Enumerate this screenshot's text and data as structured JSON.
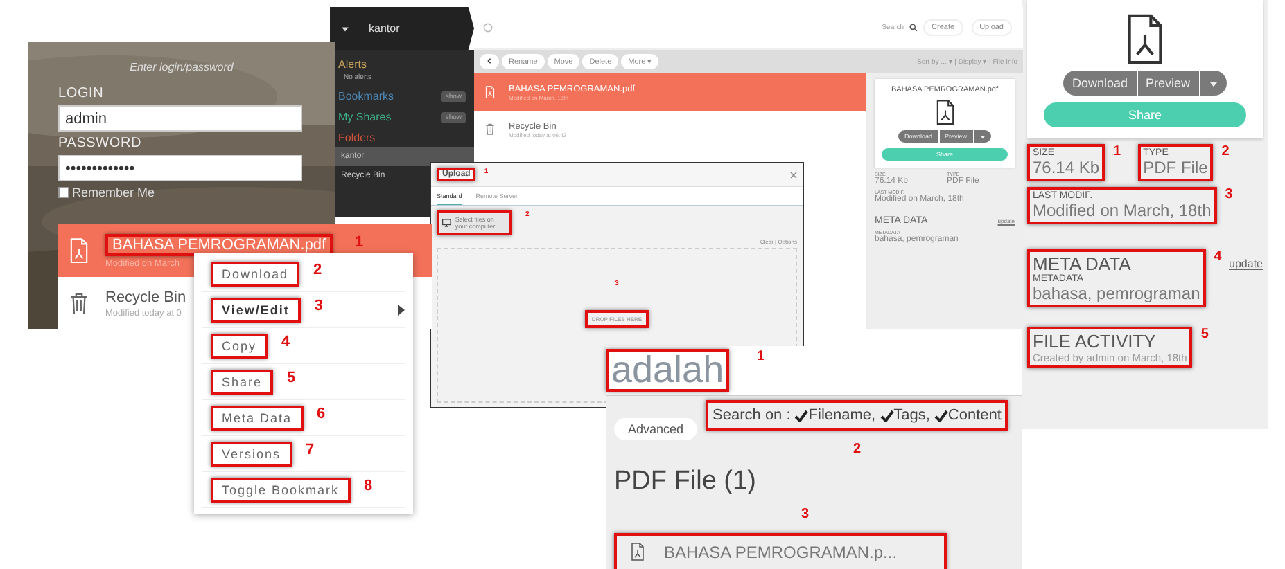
{
  "login": {
    "hint": "Enter login/password",
    "login_label": "LOGIN",
    "login_value": "admin",
    "password_label": "PASSWORD",
    "password_value": "•••••••••••••",
    "remember": {
      "label": "Remember Me",
      "checked": false
    }
  },
  "app": {
    "folder": "kantor",
    "sidebar": [
      {
        "kind": "section",
        "title": "Alerts",
        "note": "No alerts",
        "color": "#c9a25a"
      },
      {
        "kind": "section",
        "title": "Bookmarks",
        "action": "show",
        "color": "#4d86b3"
      },
      {
        "kind": "section",
        "title": "My Shares",
        "action": "show",
        "color": "#3fb08a"
      },
      {
        "kind": "section",
        "title": "Folders",
        "color": "#d0533c"
      },
      {
        "kind": "item",
        "label": "kantor",
        "selected": true
      },
      {
        "kind": "item",
        "label": "Recycle Bin",
        "selected": false
      }
    ],
    "search_placeholder": "Search",
    "top_buttons": [
      "Create",
      "Upload"
    ],
    "toolbar": [
      "Rename",
      "Move",
      "Delete",
      "More ▾"
    ],
    "view_links": "Sort by ... ▾ | Display ▾ | File Info",
    "rows": [
      {
        "name": "BAHASA PEMROGRAMAN.pdf",
        "subtitle": "Modified on March, 18th",
        "kind": "pdf",
        "selected": true
      },
      {
        "name": "Recycle Bin",
        "subtitle": "Modified today at 06:42",
        "kind": "trash",
        "selected": false
      }
    ],
    "info": {
      "name": "BAHASA PEMROGRAMAN.pdf",
      "download": "Download",
      "preview": "Preview",
      "share": "Share",
      "size_label": "SIZE",
      "size": "76.14 Kb",
      "type_label": "TYPE",
      "type": "PDF File",
      "modified_label": "LAST MODIF.",
      "modified": "Modified on March, 18th",
      "meta_title": "META DATA",
      "update": "update",
      "meta_label": "METADATA",
      "meta": "bahasa, pemrograman"
    }
  },
  "upload_dialog": {
    "title": "Upload",
    "title_callout": "1",
    "tabs": [
      {
        "label": "Standard",
        "selected": true
      },
      {
        "label": "Remote Server",
        "selected": false
      }
    ],
    "select": "Select files on your computer",
    "select_callout": "2",
    "options": "Clear | Options",
    "drop": "DROP FILES HERE",
    "drop_callout": "3"
  },
  "file_list": [
    {
      "name": "BAHASA PEMROGRAMAN.pdf",
      "subtitle": "Modified on March",
      "kind": "pdf",
      "selected": true,
      "callout": "1"
    },
    {
      "name": "Recycle Bin",
      "subtitle": "Modified today at 0",
      "kind": "trash",
      "selected": false
    }
  ],
  "context_menu": [
    {
      "label": "Download",
      "callout": "2",
      "submenu": false,
      "bold": false
    },
    {
      "label": "View/Edit",
      "callout": "3",
      "submenu": true,
      "bold": true
    },
    {
      "label": "Copy",
      "callout": "4",
      "submenu": false,
      "bold": false
    },
    {
      "label": "Share",
      "callout": "5",
      "submenu": false,
      "bold": false
    },
    {
      "label": "Meta Data",
      "callout": "6",
      "submenu": false,
      "bold": false
    },
    {
      "label": "Versions",
      "callout": "7",
      "submenu": false,
      "bold": false
    },
    {
      "label": "Toggle Bookmark",
      "callout": "8",
      "submenu": false,
      "bold": false
    }
  ],
  "search": {
    "query": "adalah",
    "query_callout": "1",
    "advanced": "Advanced",
    "search_on": "Search on :",
    "options": [
      {
        "label": "Filename,",
        "checked": true
      },
      {
        "label": "Tags,",
        "checked": true
      },
      {
        "label": "Content",
        "checked": true
      }
    ],
    "options_callout": "2",
    "group": "PDF File (1)",
    "result": "BAHASA PEMROGRAMAN.p...",
    "result_callout": "3"
  },
  "details": {
    "download": "Download",
    "preview": "Preview",
    "share": "Share",
    "fields": [
      {
        "label": "SIZE",
        "value": "76.14 Kb",
        "callout": "1"
      },
      {
        "label": "TYPE",
        "value": "PDF File",
        "callout": "2"
      },
      {
        "label": "LAST MODIF.",
        "value": "Modified on March, 18th",
        "callout": "3"
      }
    ],
    "meta_title": "META DATA",
    "meta_label": "METADATA",
    "meta": "bahasa, pemrograman",
    "meta_callout": "4",
    "update": "update",
    "activity_title": "FILE ACTIVITY",
    "activity": "Created by admin on March, 18th",
    "activity_callout": "5"
  }
}
